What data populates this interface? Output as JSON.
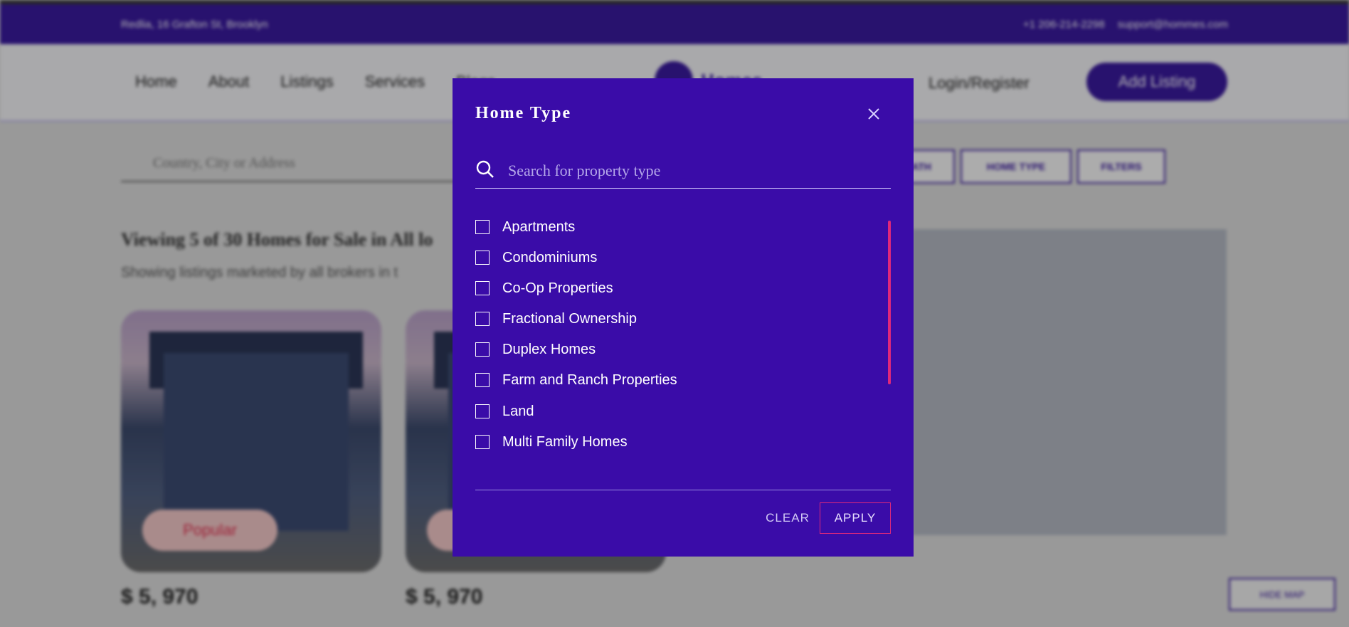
{
  "topbar": {
    "address": "Redlia, 16 Grafton St, Brooklyn",
    "phone": "+1 206-214-2298",
    "email": "support@hommes.com"
  },
  "nav": {
    "items": [
      "Home",
      "About",
      "Listings",
      "Services",
      "Blogs"
    ],
    "logo": "Homes",
    "login": "Login/Register",
    "add_listing": "Add Listing"
  },
  "search_bar": {
    "placeholder": "Country, City or Address"
  },
  "filters": [
    "BATH",
    "HOME TYPE",
    "FILTERS"
  ],
  "results": {
    "title": "Viewing 5 of 30 Homes for Sale in All lo",
    "subtitle": "Showing listings marketed by all brokers in t"
  },
  "cards": [
    {
      "badge": "Popular",
      "price": "$ 5, 970"
    },
    {
      "badge": "Popular",
      "price": "$ 5, 970"
    }
  ],
  "hide_map": "HIDE MAP",
  "modal": {
    "title": "Home Type",
    "search_placeholder": "Search for property type",
    "options": [
      "Apartments",
      "Condominiums",
      "Co-Op Properties",
      "Fractional Ownership",
      "Duplex Homes",
      "Farm and Ranch Properties",
      "Land",
      "Multi Family Homes"
    ],
    "clear_label": "CLEAR",
    "apply_label": "APPLY"
  },
  "colors": {
    "modal_bg": "#3a0ca8",
    "accent_pink": "#e0287a",
    "brand_purple": "#3a1a9e"
  }
}
